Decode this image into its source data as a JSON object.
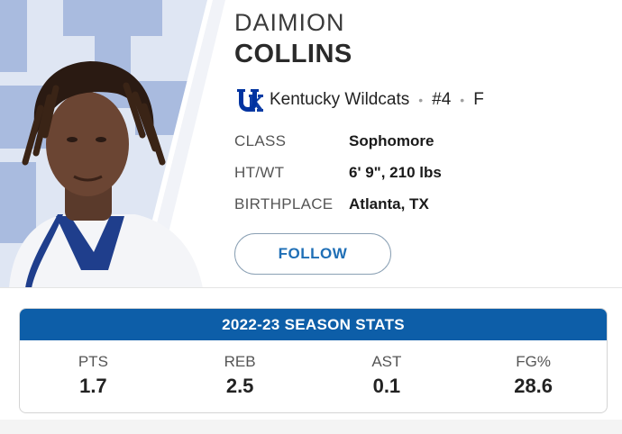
{
  "player": {
    "first_name": "DAIMION",
    "last_name": "COLLINS",
    "team": "Kentucky Wildcats",
    "number": "#4",
    "position": "F"
  },
  "info": [
    {
      "label": "CLASS",
      "value": "Sophomore"
    },
    {
      "label": "HT/WT",
      "value": "6' 9\", 210 lbs"
    },
    {
      "label": "BIRTHPLACE",
      "value": "Atlanta, TX"
    }
  ],
  "follow_label": "FOLLOW",
  "stats": {
    "title": "2022-23 SEASON STATS",
    "items": [
      {
        "label": "PTS",
        "value": "1.7"
      },
      {
        "label": "REB",
        "value": "2.5"
      },
      {
        "label": "AST",
        "value": "0.1"
      },
      {
        "label": "FG%",
        "value": "28.6"
      }
    ]
  },
  "colors": {
    "brand_blue": "#0d5ea8",
    "link_blue": "#1f6fb6",
    "logo_blue": "#0033a0"
  },
  "icons": {
    "team_logo": "uk-logo-icon",
    "separator": "dot-separator"
  }
}
